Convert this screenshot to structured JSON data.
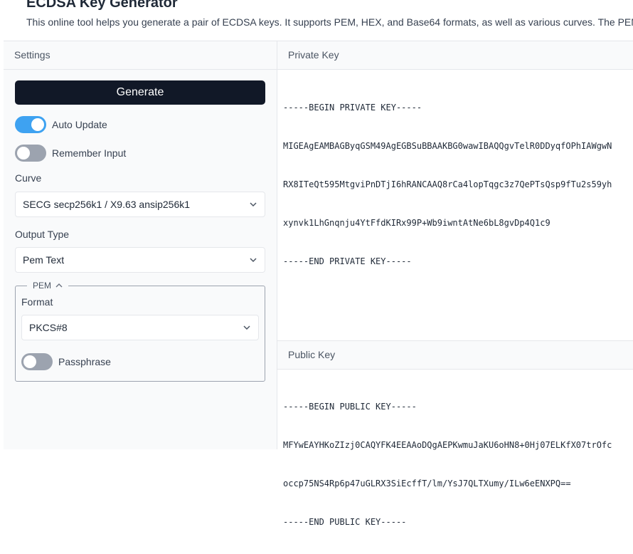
{
  "header": {
    "title": "ECDSA Key Generator",
    "subtitle": "This online tool helps you generate a pair of ECDSA keys. It supports PEM, HEX, and Base64 formats, as well as various curves. The PEM fo"
  },
  "settings": {
    "header": "Settings",
    "generate_label": "Generate",
    "auto_update": {
      "label": "Auto Update",
      "on": true
    },
    "remember_input": {
      "label": "Remember Input",
      "on": false
    },
    "curve": {
      "label": "Curve",
      "value": "SECG secp256k1 / X9.63 ansip256k1"
    },
    "output_type": {
      "label": "Output Type",
      "value": "Pem Text"
    },
    "pem": {
      "legend": "PEM",
      "format": {
        "label": "Format",
        "value": "PKCS#8"
      },
      "passphrase": {
        "label": "Passphrase",
        "on": false
      }
    }
  },
  "private_key": {
    "header": "Private Key",
    "lines": [
      "-----BEGIN PRIVATE KEY-----",
      "MIGEAgEAMBAGByqGSM49AgEGBSuBBAAKBG0wawIBAQQgvTelR0DDyqfOPhIAWgwN",
      "RX8ITeQt595MtgviPnDTjI6hRANCAAQ8rCa4lopTqgc3z7QePTsQsp9fTu2s59yh",
      "xynvk1LhGnqnju4YtFfdKIRx99P+Wb9iwntAtNe6bL8gvDp4Q1c9",
      "-----END PRIVATE KEY-----"
    ]
  },
  "public_key": {
    "header": "Public Key",
    "lines": [
      "-----BEGIN PUBLIC KEY-----",
      "MFYwEAYHKoZIzj0CAQYFK4EEAAoDQgAEPKwmuJaKU6oHN8+0Hj07ELKfX07trOfc",
      "occp75NS4Rp6p47uGLRX3SiEcffT/lm/YsJ7QLTXumy/ILw6eENXPQ==",
      "-----END PUBLIC KEY-----"
    ]
  },
  "colors": {
    "accent": "#3ea2f1",
    "button_bg": "#111827"
  },
  "icons": {
    "select_chevron": "chevron-down-icon",
    "pem_collapse": "chevron-up-icon"
  }
}
